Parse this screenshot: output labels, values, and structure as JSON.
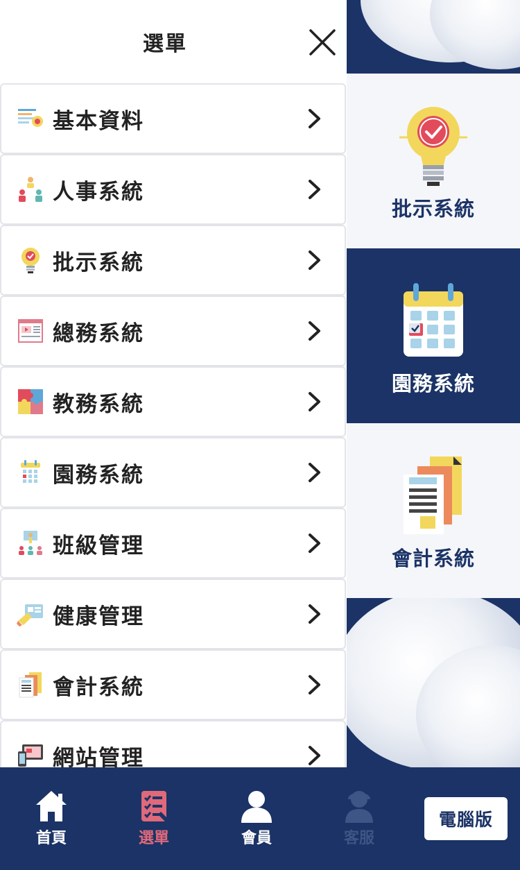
{
  "drawer": {
    "title": "選單",
    "items": [
      {
        "label": "基本資料",
        "icon": "profile-settings-icon"
      },
      {
        "label": "人事系統",
        "icon": "people-org-icon"
      },
      {
        "label": "批示系統",
        "icon": "lightbulb-check-icon"
      },
      {
        "label": "總務系統",
        "icon": "document-video-icon"
      },
      {
        "label": "教務系統",
        "icon": "puzzle-icon"
      },
      {
        "label": "園務系統",
        "icon": "calendar-icon"
      },
      {
        "label": "班級管理",
        "icon": "classroom-icon"
      },
      {
        "label": "健康管理",
        "icon": "health-card-icon"
      },
      {
        "label": "會計系統",
        "icon": "accounting-docs-icon"
      },
      {
        "label": "網站管理",
        "icon": "website-devices-icon"
      }
    ]
  },
  "tiles": [
    {
      "label": "批示系統",
      "icon": "lightbulb-check-icon"
    },
    {
      "label": "園務系統",
      "icon": "calendar-icon"
    },
    {
      "label": "會計系統",
      "icon": "accounting-docs-icon"
    }
  ],
  "bottom_nav": {
    "home": "首頁",
    "menu": "選單",
    "member": "會員",
    "support": "客服",
    "desktop": "電腦版"
  },
  "colors": {
    "navy": "#1b3366",
    "active": "#e0697a",
    "disabled": "#3d5685"
  }
}
